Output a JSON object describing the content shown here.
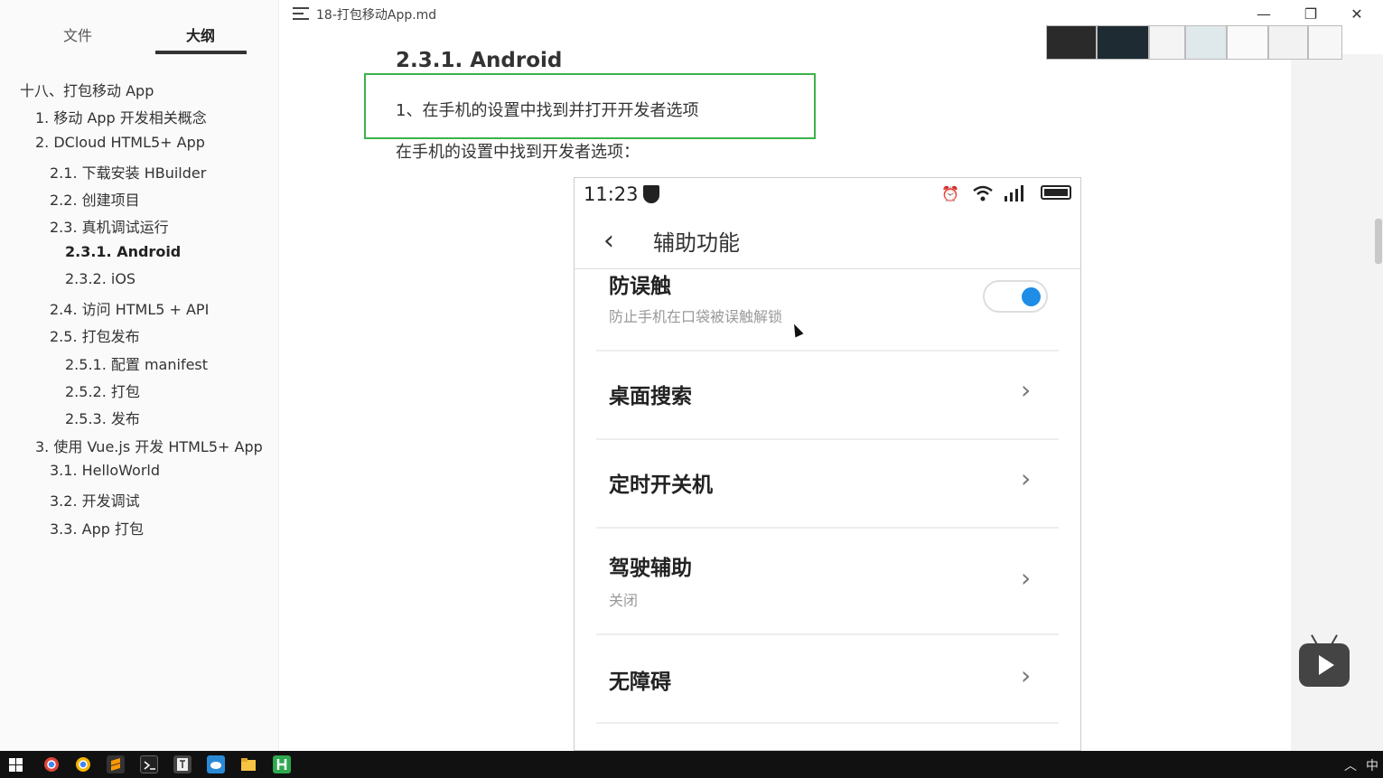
{
  "sidebar": {
    "tabs": {
      "files": "文件",
      "outline": "大纲"
    },
    "outline": [
      {
        "label": "十八、打包移动 App",
        "level": 0
      },
      {
        "label": "1. 移动 App 开发相关概念",
        "level": 1
      },
      {
        "label": "2. DCloud HTML5+ App",
        "level": 1
      },
      {
        "label": "2.1. 下载安装 HBuilder",
        "level": 2
      },
      {
        "label": "2.2. 创建项目",
        "level": 2
      },
      {
        "label": "2.3. 真机调试运行",
        "level": 2
      },
      {
        "label": "2.3.1. Android",
        "level": 3,
        "active": true
      },
      {
        "label": "2.3.2. iOS",
        "level": 3
      },
      {
        "label": "2.4. 访问 HTML5 + API",
        "level": 2
      },
      {
        "label": "2.5. 打包发布",
        "level": 2
      },
      {
        "label": "2.5.1. 配置 manifest",
        "level": 3
      },
      {
        "label": "2.5.2. 打包",
        "level": 3
      },
      {
        "label": "2.5.3. 发布",
        "level": 3
      },
      {
        "label": "3. 使用 Vue.js 开发 HTML5+ App",
        "level": 1
      },
      {
        "label": "3.1. HelloWorld",
        "level": 2
      },
      {
        "label": "3.2. 开发调试",
        "level": 2
      },
      {
        "label": "3.3. App 打包",
        "level": 2
      }
    ]
  },
  "window": {
    "title": "18-打包移动App.md",
    "minimize": "—",
    "restore": "❐",
    "close": "✕"
  },
  "doc": {
    "heading": "2.3.1. Android",
    "step": "1、在手机的设置中找到并打开开发者选项",
    "paragraph": "在手机的设置中找到开发者选项："
  },
  "phone": {
    "time": "11:23",
    "header_title": "辅助功能",
    "rows": [
      {
        "title": "防误触",
        "subtitle": "防止手机在口袋被误触解锁",
        "toggle": true
      },
      {
        "title": "桌面搜索",
        "subtitle": ""
      },
      {
        "title": "定时开关机",
        "subtitle": ""
      },
      {
        "title": "驾驶辅助",
        "subtitle": "关闭"
      },
      {
        "title": "无障碍",
        "subtitle": ""
      }
    ]
  },
  "taskbar": {
    "tray_ime": "中",
    "tray_chevron": "︿"
  },
  "colors": {
    "highlight_border": "#3bb34a",
    "toggle_on": "#1f8ce6",
    "taskbar_bg": "#111111"
  }
}
